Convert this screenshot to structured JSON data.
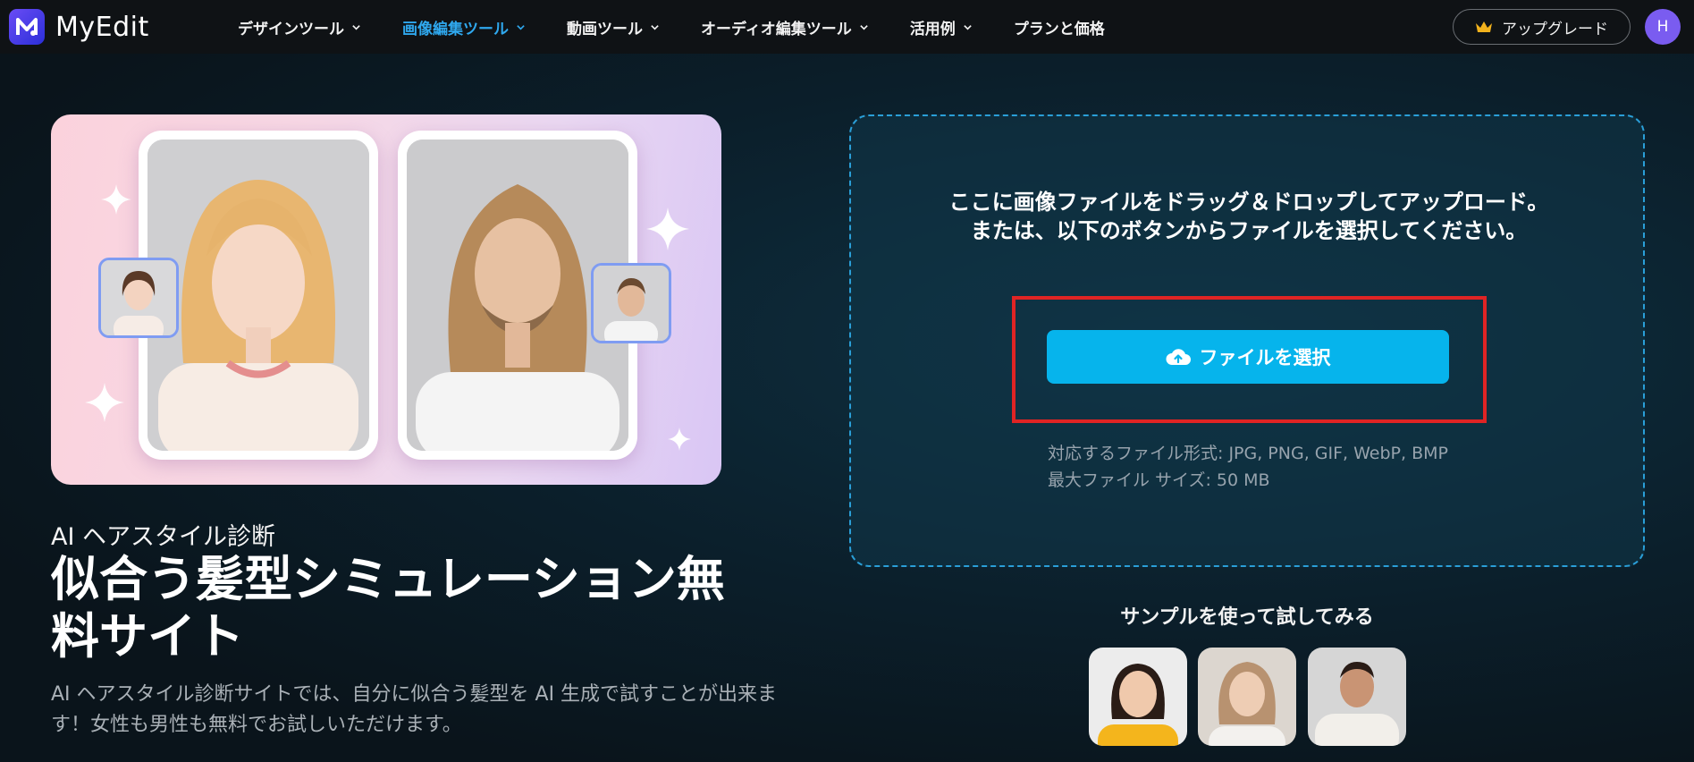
{
  "brand": {
    "name": "MyEdit"
  },
  "nav": {
    "items": [
      {
        "label": "デザインツール",
        "active": false,
        "dropdown": true
      },
      {
        "label": "画像編集ツール",
        "active": true,
        "dropdown": true
      },
      {
        "label": "動画ツール",
        "active": false,
        "dropdown": true
      },
      {
        "label": "オーディオ編集ツール",
        "active": false,
        "dropdown": true
      },
      {
        "label": "活用例",
        "active": false,
        "dropdown": true
      },
      {
        "label": "プランと価格",
        "active": false,
        "dropdown": false
      }
    ],
    "upgrade_label": "アップグレード",
    "avatar_initial": "H"
  },
  "hero": {
    "eyebrow": "AI ヘアスタイル診断",
    "title": "似合う髪型シミュレーション無料サイト",
    "description": "AI ヘアスタイル診断サイトでは、自分に似合う髪型を AI 生成で試すことが出来ます！女性も男性も無料でお試しいただけます。"
  },
  "upload": {
    "instructions": "ここに画像ファイルをドラッグ＆ドロップしてアップロード。または、以下のボタンからファイルを選択してください。",
    "button_label": "ファイルを選択",
    "formats_label": "対応するファイル形式: JPG, PNG, GIF, WebP, BMP",
    "max_size_label": "最大ファイル サイズ: 50 MB"
  },
  "samples": {
    "label": "サンプルを使って試してみる",
    "items": [
      "sample-woman-yellow",
      "sample-woman-blonde",
      "sample-man-sweater"
    ]
  },
  "colors": {
    "accent": "#06b4ec",
    "active_nav": "#2fa8ee",
    "highlight": "#e02424",
    "upload_border": "#2a9fd8"
  }
}
